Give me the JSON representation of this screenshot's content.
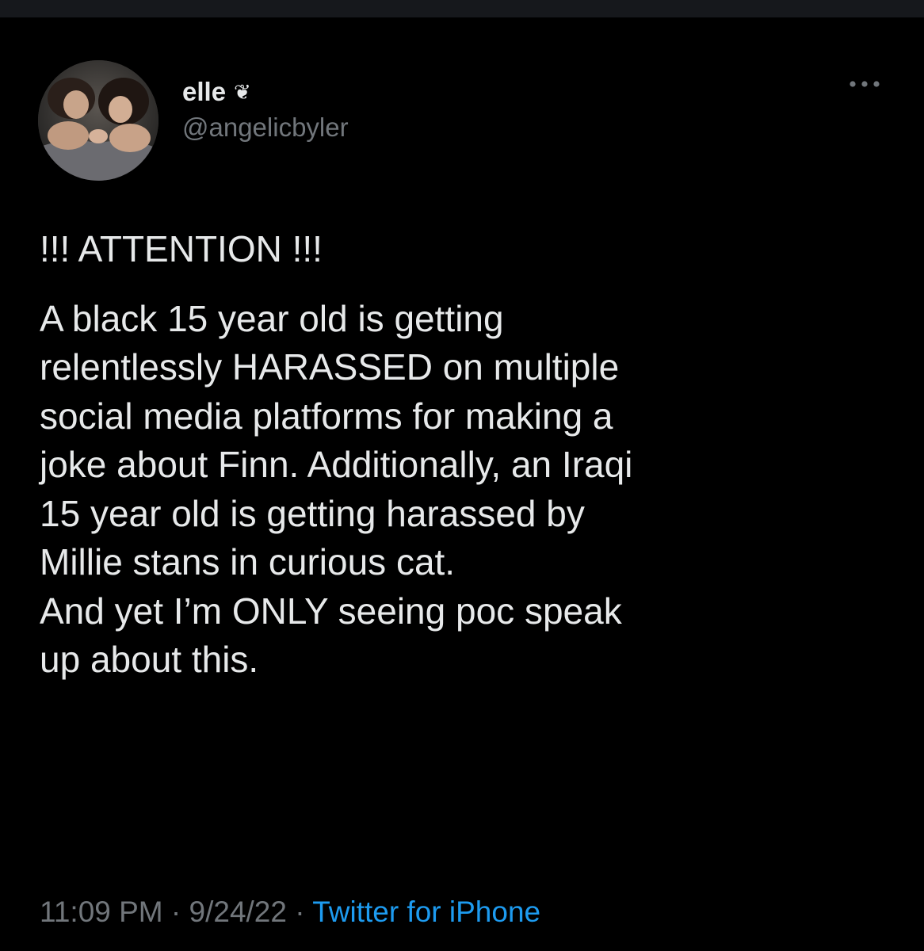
{
  "tweet": {
    "author": {
      "display_name": "elle",
      "name_emoji": "❦",
      "handle": "@angelicbyler"
    },
    "heading": "!!! ATTENTION !!!",
    "body": "A black 15 year old is getting\nrelentlessly HARASSED on multiple\nsocial media platforms for making a\njoke about Finn. Additionally, an Iraqi\n15 year old is getting harassed by\nMillie stans in curious cat.\nAnd yet I’m ONLY seeing poc speak\nup about this.",
    "time": "11:09 PM",
    "separator": " · ",
    "date": "9/24/22",
    "source": "Twitter for iPhone"
  },
  "colors": {
    "background": "#000000",
    "text": "#e7e9ea",
    "secondary_text": "#71767b",
    "link": "#1d9bf0"
  },
  "icons": {
    "more": "more-horizontal-icon",
    "verified_style": "heart-emoji-icon"
  }
}
